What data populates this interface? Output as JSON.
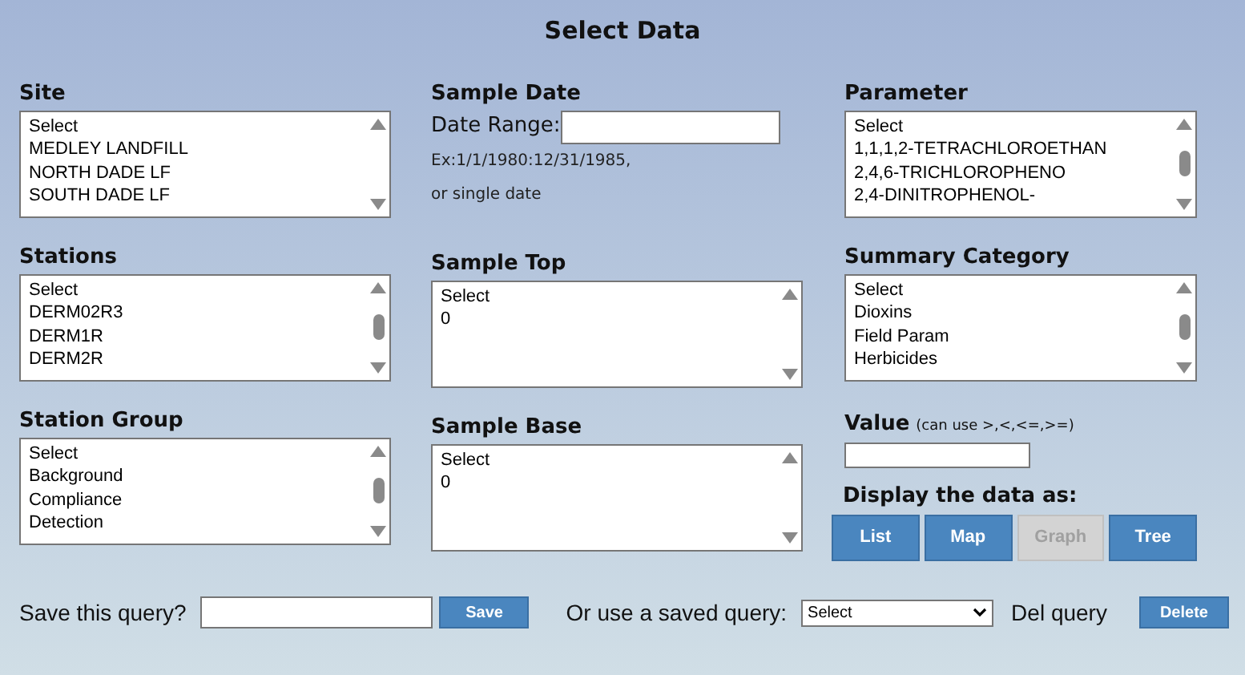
{
  "title": "Select Data",
  "columns": [
    [
      {
        "kind": "listbox",
        "label": "Site",
        "thumb": false,
        "options": [
          "Select",
          "MEDLEY LANDFILL",
          "NORTH DADE LF",
          "SOUTH DADE LF"
        ]
      },
      {
        "kind": "listbox",
        "label": "Stations",
        "thumb": true,
        "options": [
          "Select",
          "DERM02R3",
          "DERM1R",
          "DERM2R"
        ]
      },
      {
        "kind": "listbox",
        "label": "Station Group",
        "thumb": true,
        "options": [
          "Select",
          "Background",
          "Compliance",
          "Detection"
        ]
      }
    ],
    [
      {
        "kind": "date",
        "label": "Sample Date",
        "field_label": "Date Range:",
        "hints": [
          "Ex:1/1/1980:12/31/1985,",
          "or single date"
        ]
      },
      {
        "kind": "listbox",
        "label": "Sample Top",
        "thumb": false,
        "options": [
          "Select",
          "0"
        ]
      },
      {
        "kind": "listbox",
        "label": "Sample Base",
        "thumb": false,
        "options": [
          "Select",
          "0"
        ]
      }
    ],
    [
      {
        "kind": "listbox",
        "label": "Parameter",
        "thumb": true,
        "options": [
          "Select",
          "1,1,1,2-TETRACHLOROETHAN",
          "2,4,6-TRICHLOROPHENO",
          "2,4-DINITROPHENOL-"
        ]
      },
      {
        "kind": "listbox",
        "label": "Summary Category",
        "thumb": true,
        "options": [
          "Select",
          "Dioxins",
          "Field Param",
          "Herbicides"
        ]
      },
      {
        "kind": "value",
        "label": "Value",
        "note": "(can use >,<,<=,>=)",
        "display_label": "Display the data as:",
        "buttons": [
          {
            "label": "List",
            "disabled": false
          },
          {
            "label": "Map",
            "disabled": false
          },
          {
            "label": "Graph",
            "disabled": true
          },
          {
            "label": "Tree",
            "disabled": false
          }
        ]
      }
    ]
  ],
  "footer": {
    "save_label": "Save this query?",
    "save_button": "Save",
    "saved_label": "Or use a saved query:",
    "saved_value": "Select",
    "del_label": "Del query",
    "delete_button": "Delete"
  }
}
